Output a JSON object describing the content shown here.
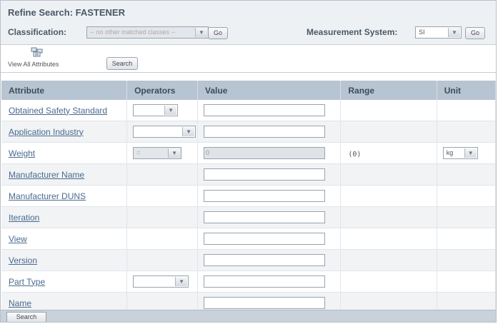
{
  "header": {
    "title": "Refine Search: FASTENER",
    "classification_label": "Classification:",
    "classification_value": "-- no other matched classes --",
    "classification_go": "Go",
    "measurement_label": "Measurement System:",
    "measurement_value": "SI",
    "measurement_go": "Go"
  },
  "toolbar": {
    "view_all_label": "View All Attributes",
    "search_label": "Search"
  },
  "table": {
    "headers": [
      "Attribute",
      "Operators",
      "Value",
      "Range",
      "Unit"
    ],
    "rows": [
      {
        "name": "Obtained Safety Standard",
        "operator": "",
        "value": "",
        "range": "",
        "unit": ""
      },
      {
        "name": "Application Industry",
        "operator": "",
        "value": "",
        "range": "",
        "unit": ""
      },
      {
        "name": "Weight",
        "operator": "=",
        "value": "0",
        "range": "(0)",
        "unit": "kg"
      },
      {
        "name": "Manufacturer Name",
        "operator": "",
        "value": "",
        "range": "",
        "unit": ""
      },
      {
        "name": "Manufacturer DUNS",
        "operator": "",
        "value": "",
        "range": "",
        "unit": ""
      },
      {
        "name": "Iteration",
        "operator": "",
        "value": "",
        "range": "",
        "unit": ""
      },
      {
        "name": "View",
        "operator": "",
        "value": "",
        "range": "",
        "unit": ""
      },
      {
        "name": "Version",
        "operator": "",
        "value": "",
        "range": "",
        "unit": ""
      },
      {
        "name": "Part Type",
        "operator": "",
        "value": "",
        "range": "",
        "unit": ""
      },
      {
        "name": "Name",
        "operator": "",
        "value": "",
        "range": "",
        "unit": ""
      }
    ]
  },
  "footer": {
    "search_label": "Search"
  }
}
